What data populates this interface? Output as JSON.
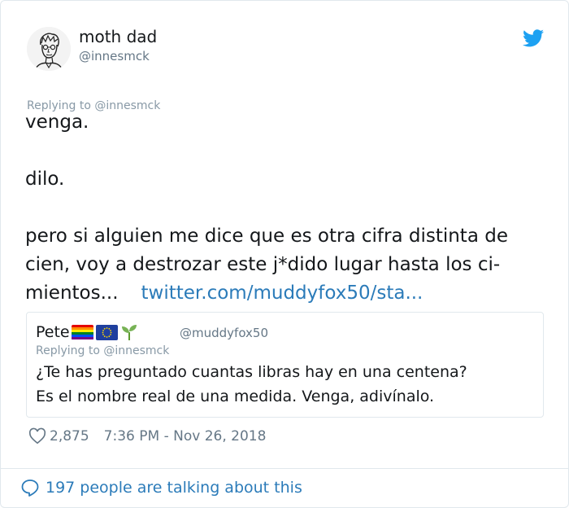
{
  "author": {
    "name": "moth dad",
    "handle": "@innesmck"
  },
  "reply_context": "Replying to @innesmck",
  "tweet": {
    "line1": "venga.",
    "line2": "dilo.",
    "line3": "pero si alguien me dice que es otra cifra distinta de",
    "line4": "cien, voy a destrozar este j*dido lugar hasta los ci-",
    "line5": "mientos...",
    "link": "twitter.com/muddyfox50/sta..."
  },
  "quoted": {
    "name": "Pete",
    "handle": "@muddyfox50",
    "reply_context": "Replying to @innesmck",
    "line1": "¿Te has preguntado cuantas libras hay en una centena?",
    "line2": "Es el nombre real de una medida. Venga, adivínalo."
  },
  "stats": {
    "likes": "2,875",
    "timestamp": "7:36 PM - Nov 26, 2018"
  },
  "conversation": "197 people are talking about this",
  "colors": {
    "link": "#2b7bb9",
    "twitter_blue": "#1da1f2",
    "muted": "#657786"
  },
  "icons": [
    "twitter-bird-icon",
    "heart-icon",
    "speech-bubble-icon",
    "rainbow-flag-icon",
    "eu-flag-icon",
    "seedling-icon"
  ]
}
